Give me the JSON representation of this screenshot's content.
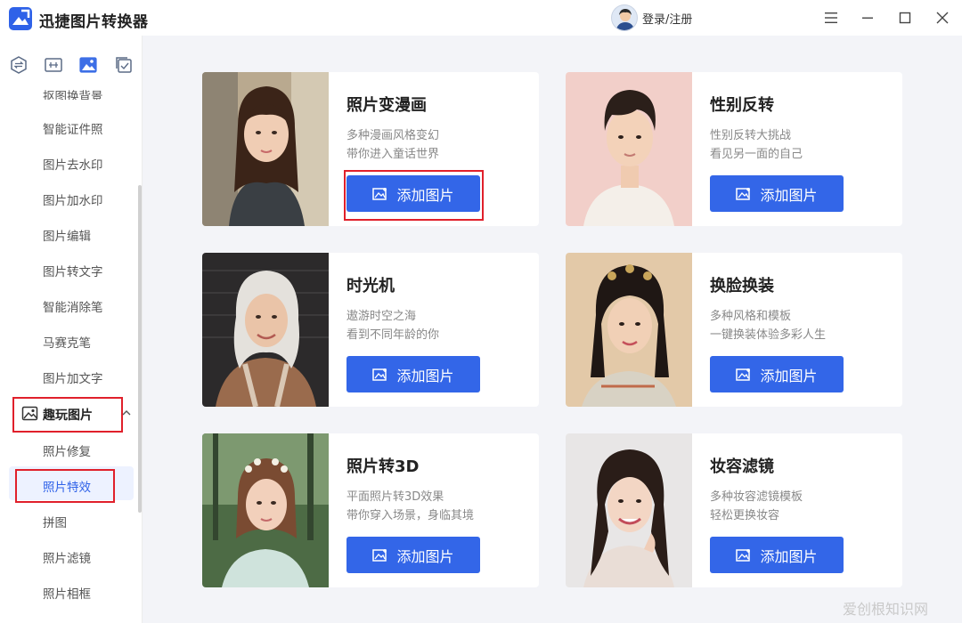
{
  "app": {
    "title": "迅捷图片转换器"
  },
  "user": {
    "login_label": "登录/注册"
  },
  "window_controls": [
    "menu-icon",
    "minimize-icon",
    "maximize-icon",
    "close-icon"
  ],
  "sidebar": {
    "top_icons": [
      "convert-icon",
      "compress-icon",
      "image-edit-icon",
      "batch-icon"
    ],
    "cut_item": "抠图换背景",
    "items": [
      "智能证件照",
      "图片去水印",
      "图片加水印",
      "图片编辑",
      "图片转文字",
      "智能消除笔",
      "马赛克笔",
      "图片加文字"
    ],
    "group": {
      "label": "趣玩图片",
      "expanded": true
    },
    "group_items": [
      "照片修复",
      "照片特效",
      "拼图",
      "照片滤镜",
      "照片相框"
    ],
    "active_item": "照片特效"
  },
  "cards": [
    {
      "title": "照片变漫画",
      "desc1": "多种漫画风格变幻",
      "desc2": "带你进入童话世界",
      "button": "添加图片"
    },
    {
      "title": "性别反转",
      "desc1": "性别反转大挑战",
      "desc2": "看见另一面的自己",
      "button": "添加图片"
    },
    {
      "title": "时光机",
      "desc1": "遨游时空之海",
      "desc2": "看到不同年龄的你",
      "button": "添加图片"
    },
    {
      "title": "换脸换装",
      "desc1": "多种风格和模板",
      "desc2": "一键换装体验多彩人生",
      "button": "添加图片"
    },
    {
      "title": "照片转3D",
      "desc1": "平面照片转3D效果",
      "desc2": "带你穿入场景，身临其境",
      "button": "添加图片"
    },
    {
      "title": "妆容滤镜",
      "desc1": "多种妆容滤镜模板",
      "desc2": "轻松更换妆容",
      "button": "添加图片"
    }
  ],
  "colors": {
    "accent": "#3366e8",
    "highlight": "#e0202b",
    "background": "#f3f4f8"
  },
  "watermark": "爱创根知识网"
}
